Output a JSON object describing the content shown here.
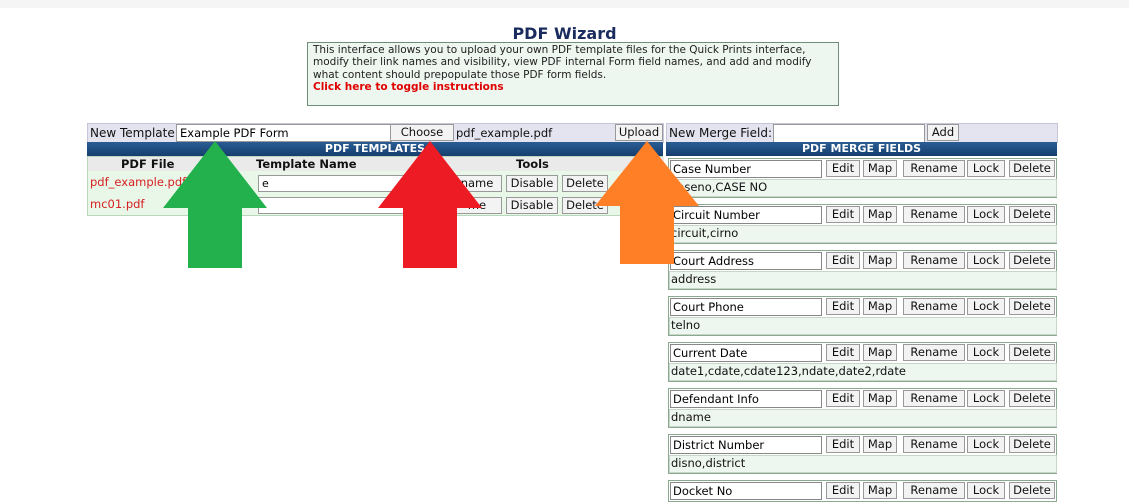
{
  "page": {
    "title": "PDF Wizard",
    "instructions": "This interface allows you to upload your own PDF template files for the Quick Prints interface, modify their link names and visibility, view PDF internal Form field names, and add and modify what content should prepopulate those PDF form fields.",
    "toggle_link": "Click here to toggle instructions"
  },
  "new_template": {
    "label": "New Template:",
    "value": "Example PDF Form",
    "choose_file_label": "Choose File",
    "selected_file": "pdf_example.pdf",
    "upload_label": "Upload"
  },
  "templates": {
    "header": "PDF TEMPLATES",
    "col_file": "PDF File",
    "col_name": "Template Name",
    "col_tools": "Tools",
    "rows": [
      {
        "file": "pdf_example.pdf",
        "name": "e",
        "rename": "name",
        "disable": "Disable",
        "delete": "Delete"
      },
      {
        "file": "mc01.pdf",
        "name": "",
        "rename": "me",
        "disable": "Disable",
        "delete": "Delete"
      }
    ]
  },
  "new_merge": {
    "label": "New Merge Field:",
    "value": "",
    "add_label": "Add"
  },
  "merge": {
    "header": "PDF MERGE FIELDS",
    "buttons": {
      "edit": "Edit",
      "map": "Map",
      "rename": "Rename",
      "lock": "Lock",
      "delete": "Delete"
    },
    "fields": [
      {
        "name": "Case Number",
        "aliases": "caseno,CASE NO"
      },
      {
        "name": "Circuit Number",
        "aliases": "circuit,cirno"
      },
      {
        "name": "Court Address",
        "aliases": "address"
      },
      {
        "name": "Court Phone",
        "aliases": "telno"
      },
      {
        "name": "Current Date",
        "aliases": "date1,cdate,cdate123,ndate,date2,rdate"
      },
      {
        "name": "Defendant Info",
        "aliases": "dname"
      },
      {
        "name": "District Number",
        "aliases": "disno,district"
      },
      {
        "name": "Docket No",
        "aliases": ""
      }
    ]
  },
  "arrows": [
    {
      "icon": "up-arrow-icon",
      "color": "#22b14c"
    },
    {
      "icon": "up-arrow-icon",
      "color": "#ed1c24"
    },
    {
      "icon": "up-arrow-icon",
      "color": "#ff7f27"
    }
  ]
}
